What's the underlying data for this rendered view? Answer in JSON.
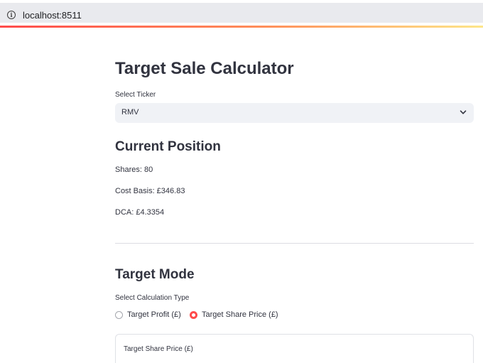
{
  "browser": {
    "url": "localhost:8511",
    "info_icon": "info-icon",
    "accent_colors": [
      "#ff4b4b",
      "#ff8f5a",
      "#fde68a"
    ]
  },
  "page": {
    "title": "Target Sale Calculator"
  },
  "ticker_select": {
    "label": "Select Ticker",
    "value": "RMV",
    "icon": "chevron-down-icon"
  },
  "current_position": {
    "heading": "Current Position",
    "shares": "Shares: 80",
    "cost_basis": "Cost Basis: £346.83",
    "dca": "DCA: £4.3354"
  },
  "target_mode": {
    "heading": "Target Mode",
    "radio_label": "Select Calculation Type",
    "options": [
      {
        "label": "Target Profit (£)",
        "selected": false
      },
      {
        "label": "Target Share Price (£)",
        "selected": true
      }
    ],
    "accent_color": "#ff4b4b"
  },
  "form": {
    "field_label": "Target Share Price (£)"
  }
}
